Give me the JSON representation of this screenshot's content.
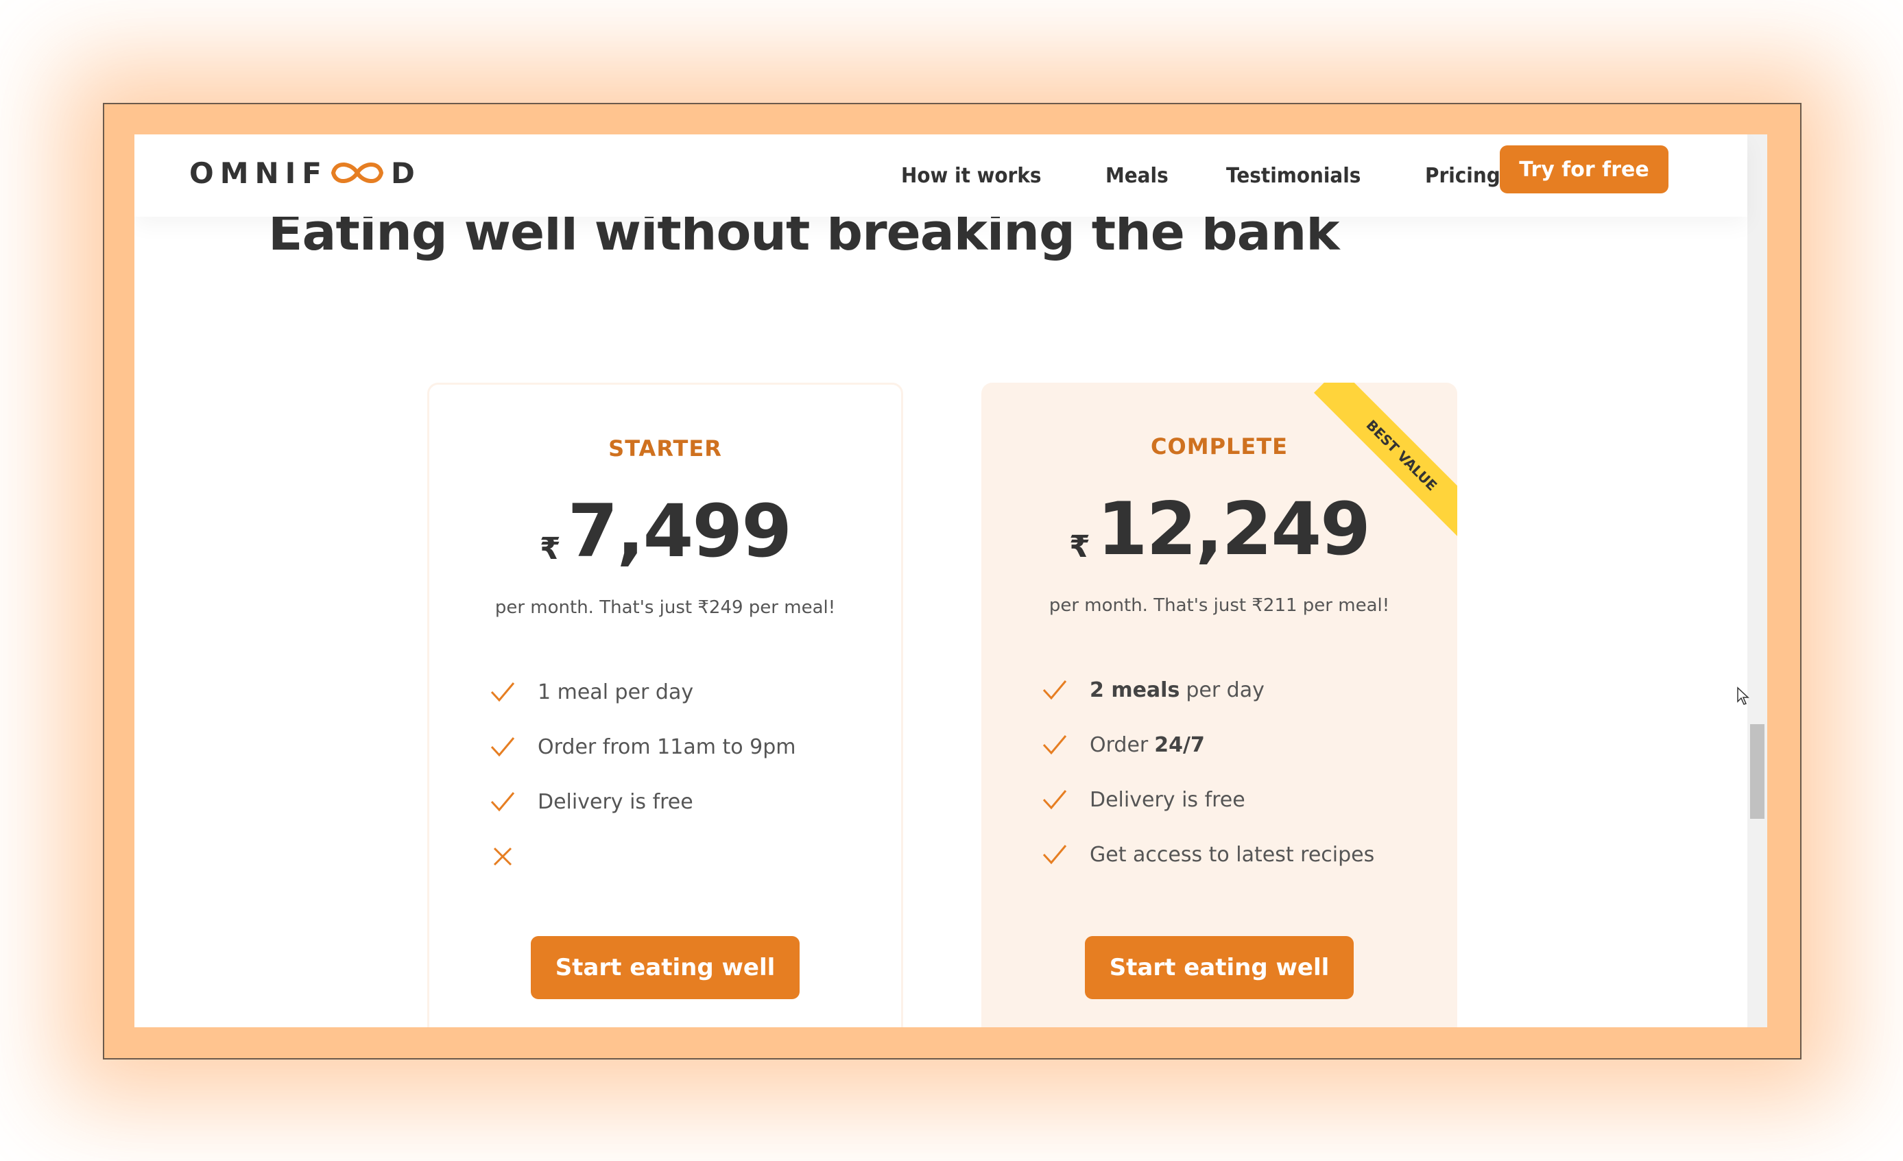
{
  "header": {
    "logo": "OMNIF",
    "logo_end": "D",
    "nav": [
      "How it works",
      "Meals",
      "Testimonials",
      "Pricing"
    ],
    "cta": "Try for free"
  },
  "section": {
    "heading": "Eating well without breaking the bank"
  },
  "plans": [
    {
      "name": "STARTER",
      "currency": "₹",
      "price": "7,499",
      "per_month": "per month. That's just ₹249 per meal!",
      "features": [
        {
          "icon": "checkmark-icon",
          "text": "1 meal per day",
          "bold": ""
        },
        {
          "icon": "checkmark-icon",
          "text": "Order from 11am to 9pm",
          "bold": ""
        },
        {
          "icon": "checkmark-icon",
          "text": "Delivery is free",
          "bold": ""
        },
        {
          "icon": "close-icon",
          "text": "",
          "bold": ""
        }
      ],
      "button": "Start eating well"
    },
    {
      "name": "COMPLETE",
      "currency": "₹",
      "price": "12,249",
      "per_month": "per month. That's just ₹211 per meal!",
      "ribbon": "BEST VALUE",
      "features": [
        {
          "icon": "checkmark-icon",
          "bold": "2 meals",
          "text": "per day"
        },
        {
          "icon": "checkmark-icon",
          "bold": "",
          "text": "Order",
          "bold_after": "24/7"
        },
        {
          "icon": "checkmark-icon",
          "bold": "",
          "text": "Delivery is free"
        },
        {
          "icon": "checkmark-icon",
          "bold": "",
          "text": "Get access to latest recipes"
        }
      ],
      "button": "Start eating well"
    }
  ],
  "colors": {
    "brand": "#e67e22",
    "plan_name": "#cf711f",
    "complete_bg": "#fdf2e9",
    "ribbon": "#ffd43b",
    "frame": "#ffc48f"
  }
}
